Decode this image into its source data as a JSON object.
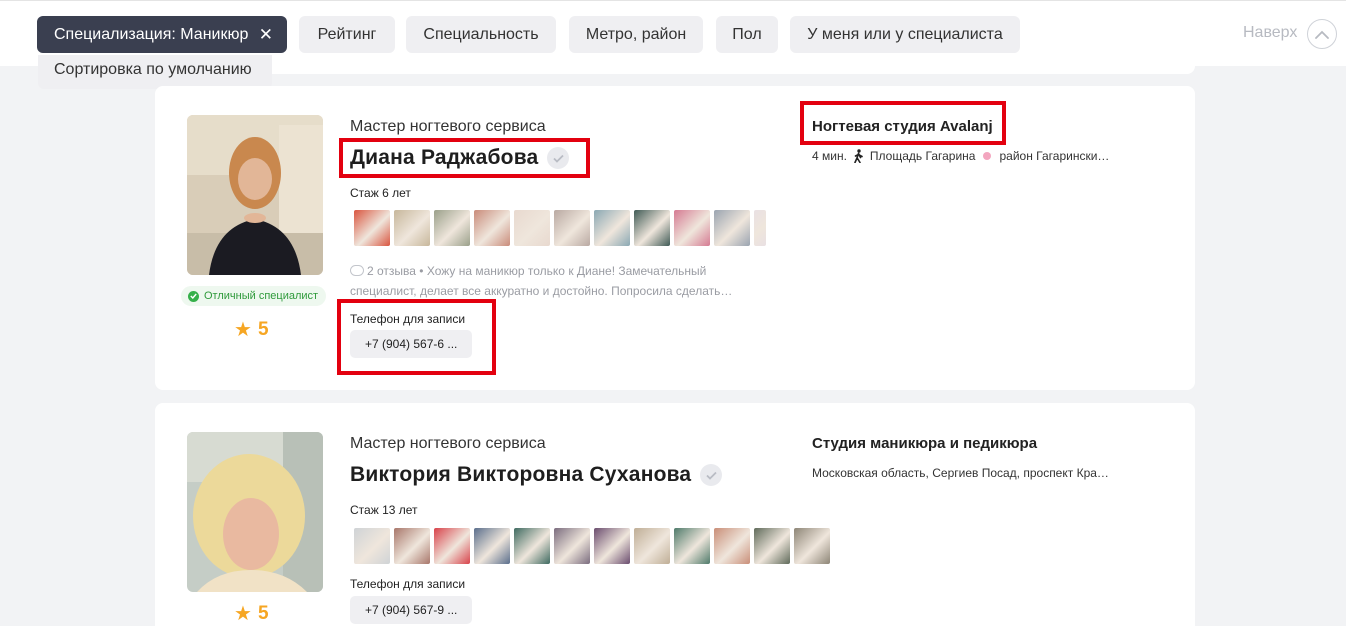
{
  "filters": {
    "active": {
      "label": "Специализация: Маникюр",
      "close_icon": "close-icon"
    },
    "items": [
      "Рейтинг",
      "Специальность",
      "Метро, район",
      "Пол",
      "У меня или у специалиста"
    ],
    "sort_label": "Сортировка по умолчанию",
    "scroll_top_label": "Наверх"
  },
  "colors": {
    "highlight": "#e3000f",
    "accent_star": "#f6a623",
    "chip_active": "#3a3f50",
    "badge_green": "#35b04a"
  },
  "specialists": [
    {
      "role": "Мастер ногтевого сервиса",
      "name": "Диана Раджабова",
      "experience": "Стаж 6 лет",
      "badge": "Отличный специалист",
      "rating": "5",
      "review_count": "2 отзыва",
      "review_text": "Хожу на маникюр только к Диане! Замечательный специалист, делает все аккуратно и достойно. Попросила сделать…",
      "phone_label": "Телефон для записи",
      "phone": "+7 (904) 567-6 ...",
      "studio": "Ногтевая студия Avalanj",
      "walk_time": "4 мин.",
      "metro": "Площадь Гагарина",
      "district": "район Гагарински…",
      "photos_count": 11
    },
    {
      "role": "Мастер ногтевого сервиса",
      "name": "Виктория Викторовна Суханова",
      "experience": "Стаж 13 лет",
      "rating": "5",
      "phone_label": "Телефон для записи",
      "phone": "+7 (904) 567-9 ...",
      "studio": "Студия маникюра и педикюра",
      "address": "Московская область, Сергиев Посад, проспект Кра…",
      "photos_count": 12
    }
  ]
}
